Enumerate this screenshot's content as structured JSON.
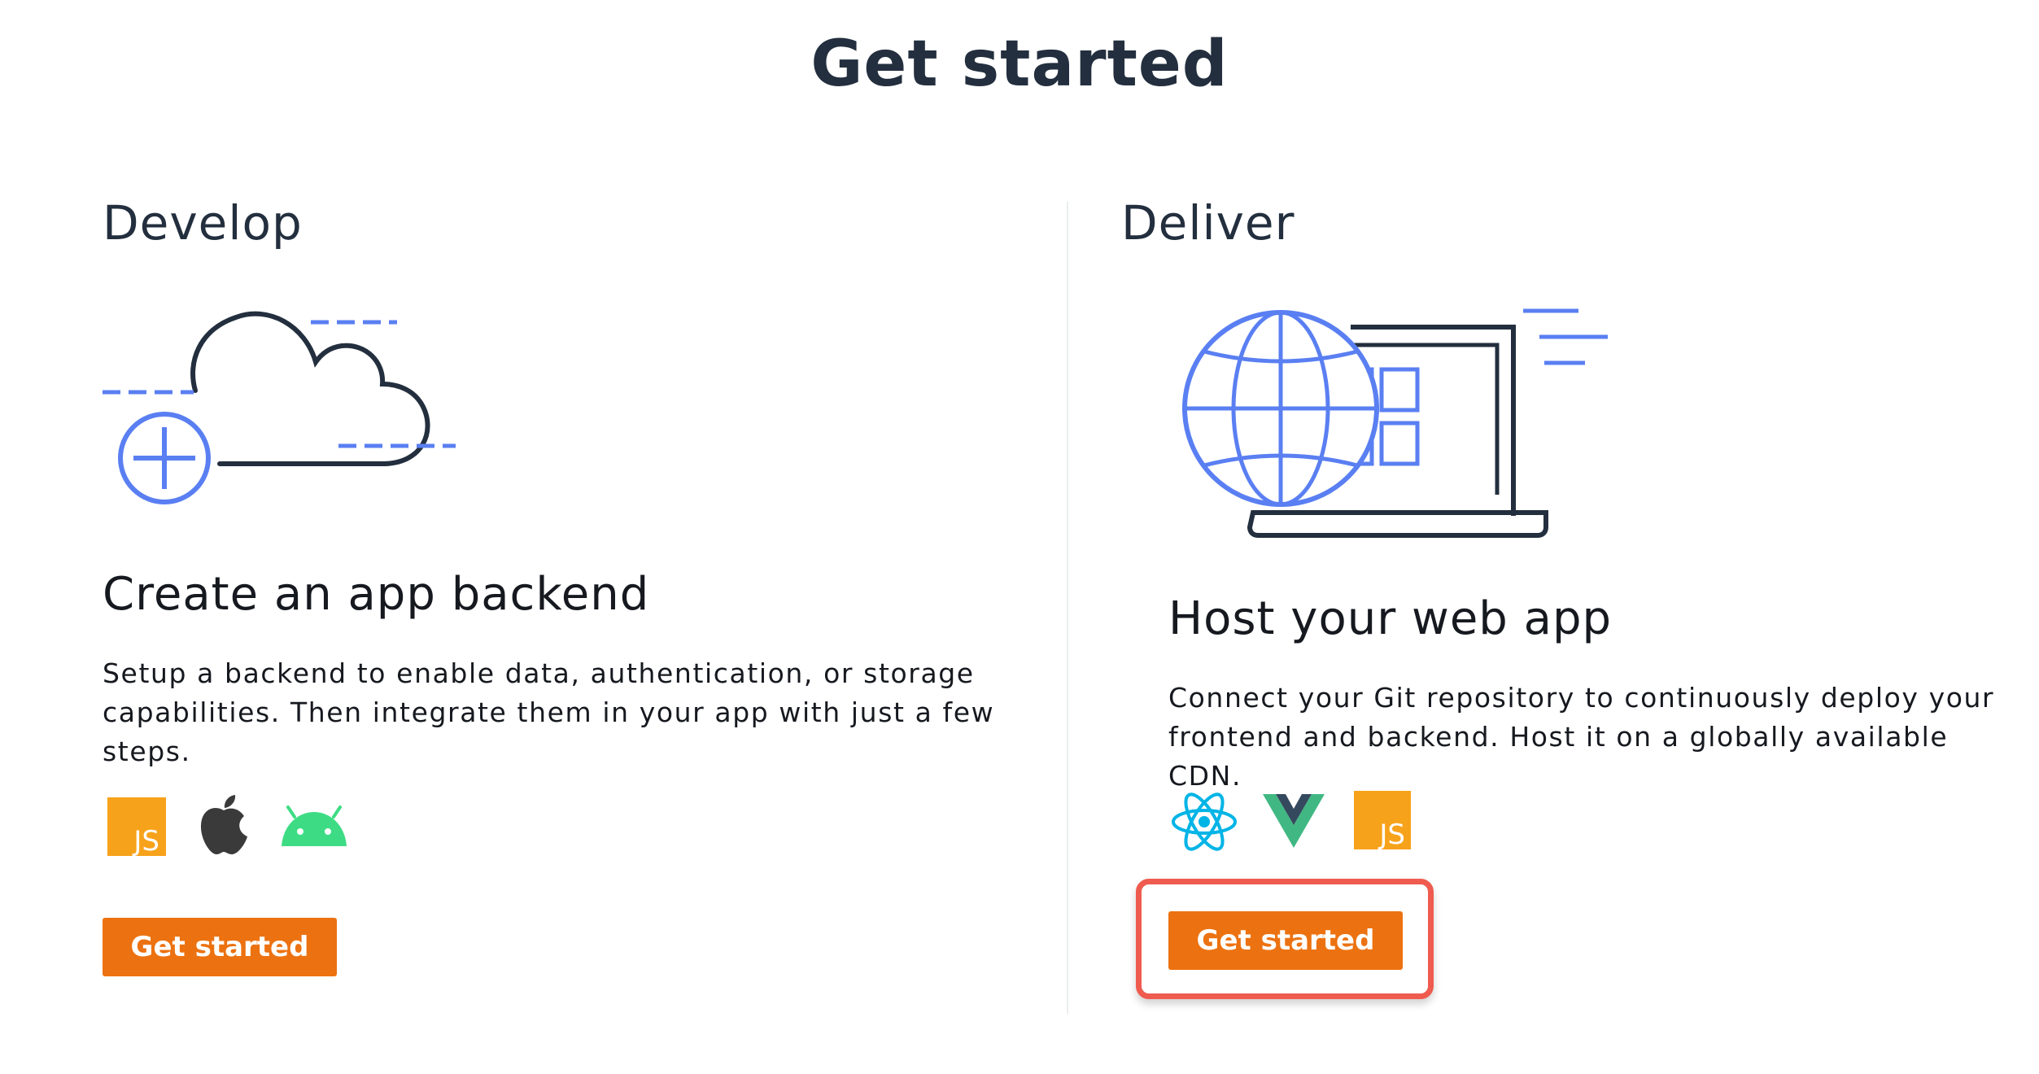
{
  "title": "Get started",
  "develop": {
    "heading": "Develop",
    "card_title": "Create an app backend",
    "description": "Setup a backend to enable data, authentication, or storage capabilities. Then integrate them in your app with just a few steps.",
    "platform_icons": [
      "javascript-icon",
      "apple-icon",
      "android-icon"
    ],
    "button_label": "Get started"
  },
  "deliver": {
    "heading": "Deliver",
    "card_title": "Host your web app",
    "description": "Connect your Git repository to continuously deploy your frontend and backend. Host it on a globally available CDN.",
    "framework_icons": [
      "react-icon",
      "vue-icon",
      "javascript-icon"
    ],
    "button_label": "Get started"
  },
  "icons": {
    "js_text": "JS"
  },
  "colors": {
    "accent_orange": "#ec7211",
    "illustration_blue": "#5a7ff2",
    "illustration_dark": "#232f3e",
    "highlight_red": "#ef5b4f",
    "react_cyan": "#00b4e6",
    "vue_green": "#41b883",
    "vue_dark": "#35495e",
    "android_green": "#3ddc84",
    "js_yellow": "#f7a21b"
  }
}
